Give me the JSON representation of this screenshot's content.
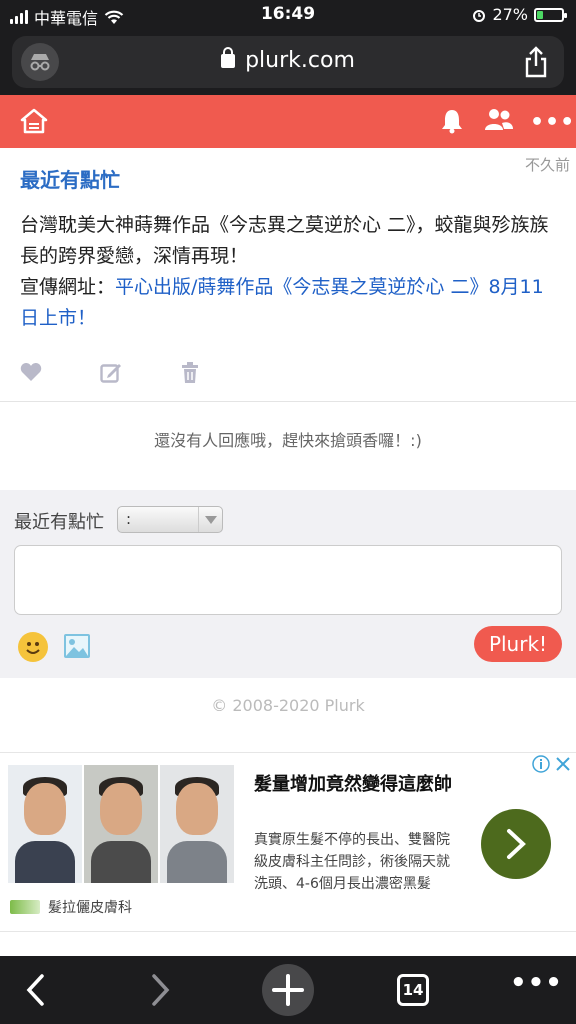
{
  "status_bar": {
    "carrier": "中華電信",
    "time": "16:49",
    "battery": "27%",
    "battery_level": 0.27
  },
  "browser": {
    "url": "plurk.com",
    "open_tabs": "14"
  },
  "post": {
    "author": "最近有點忙",
    "time": "不久前",
    "text_line1": "台灣耽美大神蒔舞作品《今志異之莫逆於心 二》，蛟龍與殄族族長的跨界愛戀，深情再現！",
    "link_prefix": "宣傳網址：",
    "link_text": "平心出版/蒔舞作品《今志異之莫逆於心 二》8月11日上市！"
  },
  "responses": {
    "empty_text": "還沒有人回應哦，趕快來搶頭香囉！:)"
  },
  "reply_form": {
    "user": "最近有點忙",
    "qualifier": ":",
    "submit_label": "Plurk!"
  },
  "footer": {
    "copyright": "© 2008-2020 Plurk"
  },
  "ad": {
    "title": "髮量增加竟然變得這麼帥",
    "description": "真實原生髮不停的長出、雙醫院級皮膚科主任問診，術後隔天就洗頭、4-6個月長出濃密黑髮",
    "advertiser": "髮拉儷皮膚科"
  },
  "colors": {
    "brand": "#f05a4f",
    "link": "#1f60c7",
    "ad_button": "#4d6a1d"
  }
}
